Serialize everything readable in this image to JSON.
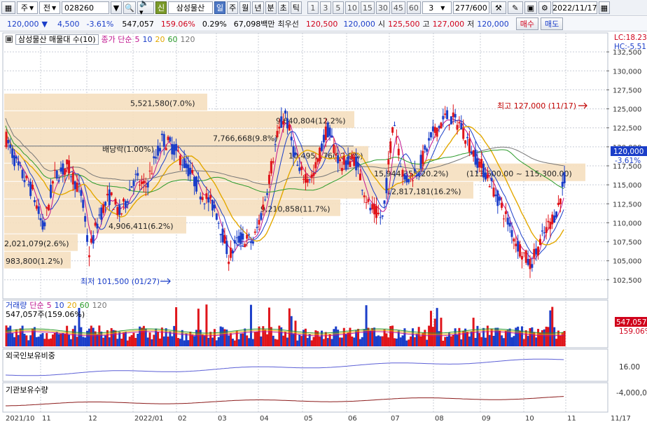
{
  "toolbar": {
    "code_prefix": "주",
    "prev_label": "전",
    "stock_code": "028260",
    "credit_badge": "신",
    "stock_name": "삼성물산",
    "period_tabs": [
      "일",
      "주",
      "월",
      "년",
      "분",
      "초",
      "틱"
    ],
    "active_period": "일",
    "interval_buttons": [
      "1",
      "3",
      "5",
      "10",
      "15",
      "30",
      "45",
      "60"
    ],
    "interval_select": "3",
    "count": "277",
    "count_total": "/600",
    "date": "2022/11/17"
  },
  "quote": {
    "price": "120,000",
    "change": "4,500",
    "change_pct": "-3.61%",
    "volume": "547,057",
    "volume_ratio": "159.06%",
    "turnover": "0.29%",
    "trade_amount": "67,098백만",
    "best_label": "최우선",
    "best_ask": "120,500",
    "best_bid": "120,000",
    "open_label": "시",
    "open": "125,500",
    "high_label": "고",
    "high": "127,000",
    "low_label": "저",
    "low": "120,000",
    "buy_button": "매수",
    "sell_button": "매도"
  },
  "price_panel": {
    "legend_box": "삼성물산 매물대 수(10)",
    "ma_label": "종가 단순",
    "ma_periods": [
      "5",
      "10",
      "20",
      "60",
      "120"
    ],
    "ma_colors": [
      "#c0148f",
      "#1b3ec9",
      "#e3a800",
      "#2a9a2a",
      "#777777"
    ],
    "lc_label": "LC:18.23",
    "hc_label": "HC:-5.51",
    "current_price_tag": "120,000",
    "current_pct_tag": "-3.61%",
    "high_note": "최고 127,000 (11/17)",
    "low_note": "최저 101,500 (01/27)",
    "dividend_note": "배당락(1.00%)",
    "y_ticks": [
      "132,500",
      "130,000",
      "127,500",
      "125,000",
      "122,500",
      "120,000",
      "117,500",
      "115,000",
      "112,500",
      "110,000",
      "107,500",
      "105,000",
      "102,500"
    ],
    "volume_profile": [
      "5,521,580(7.0%)",
      "9,640,804(12.2%)",
      "7,766,668(9.8%)",
      "10,495,176(12.9%)",
      "15,944,355(20.2%)",
      "12,817,181(16.2%)",
      "9,210,858(11.7%)",
      "4,906,411(6.2%)",
      "2,021,079(2.6%)",
      "983,800(1.2%)"
    ],
    "range_note": "(113,600.00 ~ 115,300.00)"
  },
  "volume_panel": {
    "title": "거래량",
    "ma_label": "단순",
    "ma_periods": [
      "5",
      "10",
      "20",
      "60",
      "120"
    ],
    "value": "547,057주(159.06%)",
    "tag_value": "547,057",
    "tag_pct": "159.06%"
  },
  "foreign_panel": {
    "title": "외국인보유비중",
    "tick": "16.00"
  },
  "inst_panel": {
    "title": "기관보유수량",
    "tick": "-4,000,0"
  },
  "x_axis": [
    "2021/10",
    "11",
    "12",
    "2022/01",
    "02",
    "03",
    "04",
    "05",
    "06",
    "07",
    "08",
    "09",
    "10",
    "11",
    "11/17"
  ]
}
